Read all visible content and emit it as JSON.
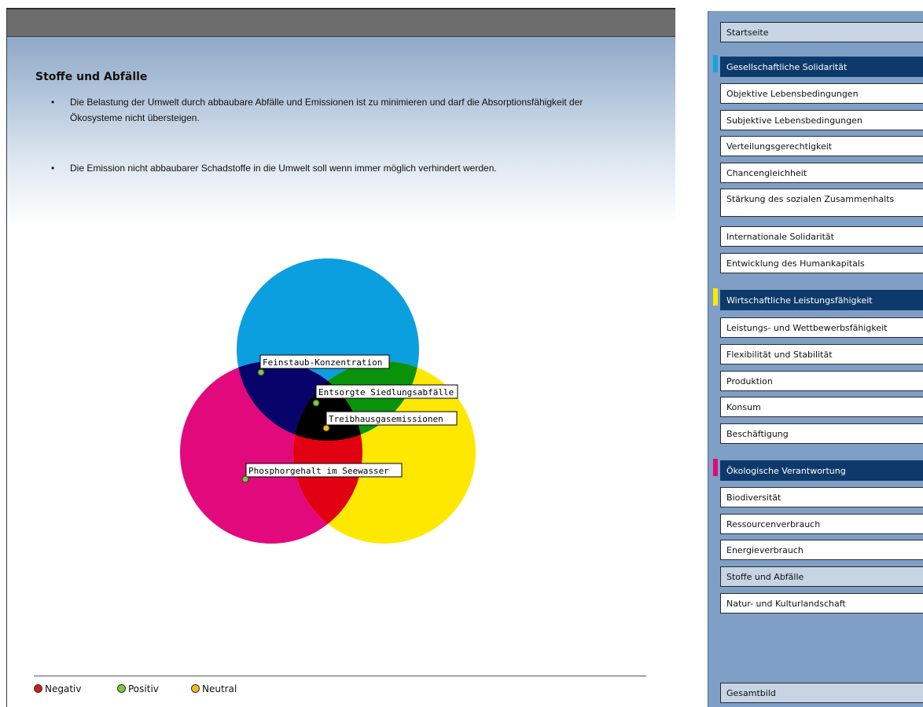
{
  "content": {
    "title": "Stoffe und Abfälle",
    "bullet_glyph": "•",
    "bullets": [
      "Die Belastung der Umwelt durch abbaubare Abfälle und Emissionen ist zu minimieren und darf die Absorptionsfähigkeit der Ökosysteme nicht übersteigen.",
      "Die Emission nicht abbaubarer Schadstoffe in die Umwelt soll wenn immer möglich verhindert werden."
    ]
  },
  "venn": {
    "circle_colors": {
      "top": "#0b9fe0",
      "left": "#e2097c",
      "right": "#ffe800"
    },
    "overlap_colors": {
      "top_left": "#07036b",
      "top_right": "#0a930a",
      "left_right": "#e10011",
      "center": "#000000"
    },
    "indicators": [
      {
        "label": "Feinstaub-Konzentration",
        "status": "Positiv"
      },
      {
        "label": "Entsorgte Siedlungsabfälle",
        "status": "Positiv"
      },
      {
        "label": "Treibhausgasemissionen",
        "status": "Neutral"
      },
      {
        "label": "Phosphorgehalt im Seewasser",
        "status": "Positiv"
      }
    ]
  },
  "legend": {
    "items": [
      {
        "label": "Negativ",
        "color": "#cc1e1e"
      },
      {
        "label": "Positiv",
        "color": "#7ac93a"
      },
      {
        "label": "Neutral",
        "color": "#f5b81c"
      }
    ]
  },
  "sidebar": {
    "marker_colors": {
      "gesellschaft": "#14a3e2",
      "wirtschaft": "#ffe800",
      "oekologie": "#e2097c"
    },
    "items": [
      "Startseite",
      "Gesellschaftliche Solidarität",
      "Objektive Lebensbedingungen",
      "Subjektive Lebensbedingungen",
      "Verteilungsgerechtigkeit",
      "Chancengleichheit",
      "Stärkung des sozialen Zusammenhalts",
      "Internationale Solidarität",
      "Entwicklung des Humankapitals",
      "Wirtschaftliche Leistungsfähigkeit",
      "Leistungs- und Wettbewerbsfähigkeit",
      "Flexibilität und Stabilität",
      "Produktion",
      "Konsum",
      "Beschäftigung",
      "Ökologische Verantwortung",
      "Biodiversität",
      "Ressourcenverbrauch",
      "Energieverbrauch",
      "Stoffe und Abfälle",
      "Natur- und Kulturlandschaft",
      "Gesamtbild"
    ]
  }
}
